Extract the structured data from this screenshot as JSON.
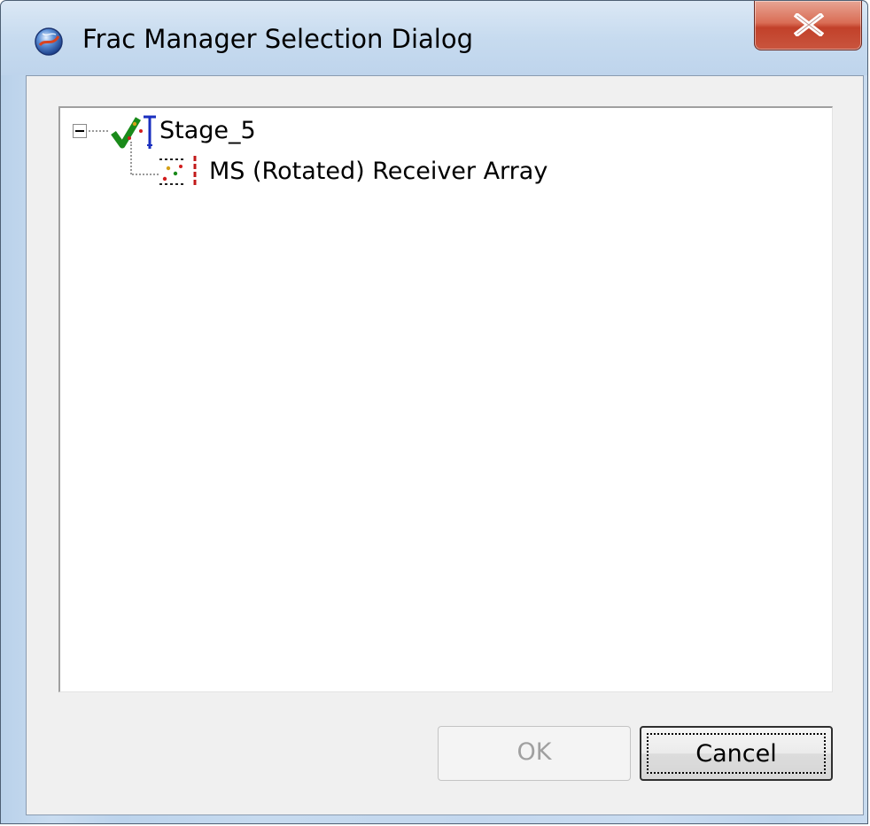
{
  "window": {
    "title": "Frac Manager Selection Dialog",
    "title_icon": "app-globe-icon",
    "close_icon": "close-x-icon"
  },
  "tree": {
    "nodes": [
      {
        "label": "Stage_5",
        "icon": "stage-checkmark-icon",
        "expanded": true,
        "children": [
          {
            "label": "MS (Rotated) Receiver Array",
            "icon": "receiver-array-icon"
          }
        ]
      }
    ]
  },
  "buttons": {
    "ok_label": "OK",
    "ok_enabled": false,
    "cancel_label": "Cancel"
  },
  "colors": {
    "close_button": "#c9553e",
    "check_green": "#1a8a1a",
    "disabled_text": "#a0a0a0"
  }
}
